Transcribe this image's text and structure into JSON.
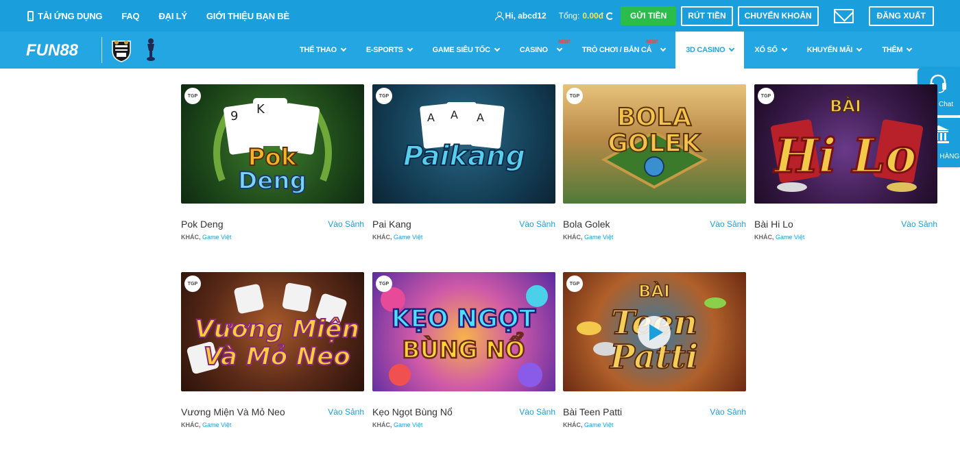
{
  "topbar": {
    "links": [
      "TẢI ỨNG DỤNG",
      "FAQ",
      "ĐẠI LÝ",
      "GIỚI THIỆU BẠN BÈ"
    ],
    "greeting": "Hi, abcd12",
    "total_label": "Tổng:",
    "total_value": "0.00đ",
    "buttons": {
      "deposit": "GỬI TIỀN",
      "withdraw": "RÚT TIỀN",
      "transfer": "CHUYỂN KHOẢN",
      "logout": "ĐĂNG XUẤT"
    }
  },
  "brand": {
    "logo": "FUN88"
  },
  "nav": {
    "items": [
      {
        "label": "THỂ THAO"
      },
      {
        "label": "E-SPORTS"
      },
      {
        "label": "GAME SIÊU TỐC"
      },
      {
        "label": "CASINO",
        "badge": "NEW!"
      },
      {
        "label": "TRÒ CHƠI / BẮN CÁ",
        "badge": "NEW!"
      },
      {
        "label": "3D CASINO",
        "active": true
      },
      {
        "label": "XỔ SỐ"
      },
      {
        "label": "KHUYẾN MÃI"
      },
      {
        "label": "THÊM"
      }
    ]
  },
  "side": {
    "live_chat": "Live Chat",
    "bank": "NGÂN HÀNG"
  },
  "games": [
    {
      "title": "Pok Deng",
      "enter": "Vào Sảnh",
      "category": "KHÁC,",
      "tag": "Game Việt",
      "badge": "TGP",
      "art": "Pok Deng"
    },
    {
      "title": "Pai Kang",
      "enter": "Vào Sảnh",
      "category": "KHÁC,",
      "tag": "Game Việt",
      "badge": "TGP",
      "art": "Paikang"
    },
    {
      "title": "Bola Golek",
      "enter": "Vào Sảnh",
      "category": "KHÁC,",
      "tag": "Game Việt",
      "badge": "TGP",
      "art": "BOLA GOLEK"
    },
    {
      "title": "Bài Hi Lo",
      "enter": "Vào Sảnh",
      "category": "KHÁC,",
      "tag": "Game Việt",
      "badge": "TGP",
      "art": "BÀI HI LO"
    },
    {
      "title": "Vương Miện Và Mỏ Neo",
      "enter": "Vào Sảnh",
      "category": "KHÁC,",
      "tag": "Game Việt",
      "badge": "TGP",
      "art": "Vương Miện Và Mỏ Neo"
    },
    {
      "title": "Kẹo Ngọt Bùng Nổ",
      "enter": "Vào Sảnh",
      "category": "KHÁC,",
      "tag": "Game Việt",
      "badge": "TGP",
      "art": "KẸO NGỌT BÙNG NỔ"
    },
    {
      "title": "Bài Teen Patti",
      "enter": "Vào Sảnh",
      "category": "KHÁC,",
      "tag": "Game Việt",
      "badge": "TGP",
      "art": "BÀI Teen Patti"
    }
  ],
  "colors": {
    "primary": "#1a9fdc",
    "nav": "#24a6e2",
    "deposit": "#2bbd4a",
    "balance": "#ffe24a"
  }
}
